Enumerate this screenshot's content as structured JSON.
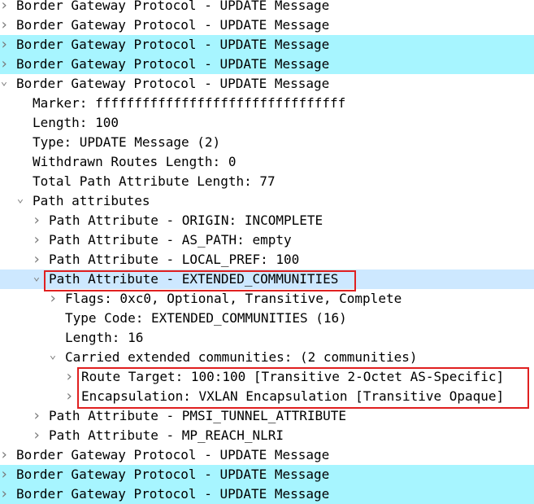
{
  "colors": {
    "highlight_cyan": "#a7f5ff",
    "selected_row": "#cde8ff",
    "annotation_red": "#e02020"
  },
  "tree": {
    "rows": [
      {
        "label": "Border Gateway Protocol - UPDATE Message",
        "level": 0,
        "arrow": "collapsed",
        "bg": "none"
      },
      {
        "label": "Border Gateway Protocol - UPDATE Message",
        "level": 0,
        "arrow": "collapsed",
        "bg": "none"
      },
      {
        "label": "Border Gateway Protocol - UPDATE Message",
        "level": 0,
        "arrow": "collapsed",
        "bg": "cyan"
      },
      {
        "label": "Border Gateway Protocol - UPDATE Message",
        "level": 0,
        "arrow": "collapsed",
        "bg": "cyan"
      },
      {
        "label": "Border Gateway Protocol - UPDATE Message",
        "level": 0,
        "arrow": "expanded",
        "bg": "none"
      },
      {
        "label": "Marker: ffffffffffffffffffffffffffffffff",
        "level": 1,
        "arrow": "none",
        "bg": "none"
      },
      {
        "label": "Length: 100",
        "level": 1,
        "arrow": "none",
        "bg": "none"
      },
      {
        "label": "Type: UPDATE Message (2)",
        "level": 1,
        "arrow": "none",
        "bg": "none"
      },
      {
        "label": "Withdrawn Routes Length: 0",
        "level": 1,
        "arrow": "none",
        "bg": "none"
      },
      {
        "label": "Total Path Attribute Length: 77",
        "level": 1,
        "arrow": "none",
        "bg": "none"
      },
      {
        "label": "Path attributes",
        "level": 1,
        "arrow": "expanded",
        "bg": "none"
      },
      {
        "label": "Path Attribute - ORIGIN: INCOMPLETE",
        "level": 2,
        "arrow": "collapsed",
        "bg": "none"
      },
      {
        "label": "Path Attribute - AS_PATH: empty",
        "level": 2,
        "arrow": "collapsed",
        "bg": "none"
      },
      {
        "label": "Path Attribute - LOCAL_PREF: 100",
        "level": 2,
        "arrow": "collapsed",
        "bg": "none"
      },
      {
        "label": "Path Attribute - EXTENDED_COMMUNITIES",
        "level": 2,
        "arrow": "expanded",
        "bg": "selected"
      },
      {
        "label": "Flags: 0xc0, Optional, Transitive, Complete",
        "level": 3,
        "arrow": "collapsed",
        "bg": "none"
      },
      {
        "label": "Type Code: EXTENDED_COMMUNITIES (16)",
        "level": 3,
        "arrow": "none",
        "bg": "none"
      },
      {
        "label": "Length: 16",
        "level": 3,
        "arrow": "none",
        "bg": "none"
      },
      {
        "label": "Carried extended communities: (2 communities)",
        "level": 3,
        "arrow": "expanded",
        "bg": "none"
      },
      {
        "label": "Route Target: 100:100 [Transitive 2-Octet AS-Specific]",
        "level": 4,
        "arrow": "collapsed",
        "bg": "none"
      },
      {
        "label": "Encapsulation: VXLAN Encapsulation [Transitive Opaque]",
        "level": 4,
        "arrow": "collapsed",
        "bg": "none"
      },
      {
        "label": "Path Attribute - PMSI_TUNNEL_ATTRIBUTE",
        "level": 2,
        "arrow": "collapsed",
        "bg": "none"
      },
      {
        "label": "Path Attribute - MP_REACH_NLRI",
        "level": 2,
        "arrow": "collapsed",
        "bg": "none"
      },
      {
        "label": "Border Gateway Protocol - UPDATE Message",
        "level": 0,
        "arrow": "collapsed",
        "bg": "none"
      },
      {
        "label": "Border Gateway Protocol - UPDATE Message",
        "level": 0,
        "arrow": "collapsed",
        "bg": "cyan"
      },
      {
        "label": "Border Gateway Protocol - UPDATE Message",
        "level": 0,
        "arrow": "collapsed",
        "bg": "cyan"
      }
    ]
  },
  "icons": {
    "collapsed": "chevron-right-icon",
    "expanded": "chevron-down-icon"
  }
}
